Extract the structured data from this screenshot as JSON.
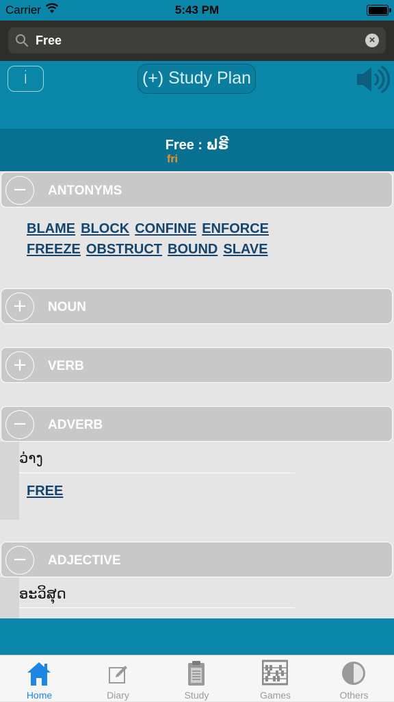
{
  "status_bar": {
    "carrier": "Carrier",
    "time": "5:43 PM"
  },
  "search": {
    "value": "Free",
    "placeholder": ""
  },
  "toolbar": {
    "info_label": "i",
    "study_plan_label": "(+) Study Plan",
    "speaker_icon": "speaker-icon"
  },
  "word": {
    "title": "Free : ຟຣີ",
    "pronunciation": "fri"
  },
  "sections": {
    "antonyms": {
      "title": "ANTONYMS",
      "toggle": "−",
      "links": [
        "BLAME",
        "BLOCK",
        "CONFINE",
        "ENFORCE",
        "FREEZE",
        "OBSTRUCT",
        "BOUND",
        "SLAVE"
      ]
    },
    "noun": {
      "title": "NOUN",
      "toggle": "+"
    },
    "verb": {
      "title": "VERB",
      "toggle": "+"
    },
    "adverb": {
      "title": "ADVERB",
      "toggle": "−",
      "meaning": "ວ່າງ",
      "links": [
        "FREE"
      ]
    },
    "adjective": {
      "title": "ADJECTIVE",
      "toggle": "−",
      "meaning": "ອະວິສຸດ"
    }
  },
  "tabs": [
    {
      "label": "Home",
      "icon": "home-icon",
      "active": true
    },
    {
      "label": "Diary",
      "icon": "diary-icon",
      "active": false
    },
    {
      "label": "Study",
      "icon": "clipboard-icon",
      "active": false
    },
    {
      "label": "Games",
      "icon": "abacus-icon",
      "active": false
    },
    {
      "label": "Others",
      "icon": "others-icon",
      "active": false
    }
  ],
  "colors": {
    "accent": "#0a86a8",
    "header": "#087192",
    "pronunciation": "#f0952a",
    "link": "#15456d",
    "tab_active": "#1d86e4"
  }
}
